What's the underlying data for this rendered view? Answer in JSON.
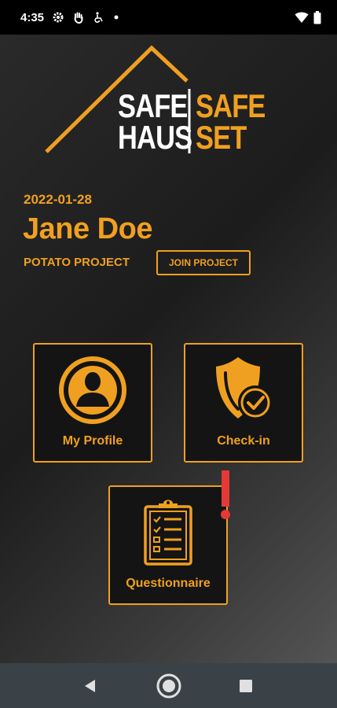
{
  "status_bar": {
    "time": "4:35",
    "icons": [
      "gear-icon",
      "hand-icon",
      "accessibility-icon",
      "dot-icon"
    ],
    "right_icons": [
      "wifi-icon",
      "battery-icon"
    ]
  },
  "logo": {
    "word_left_top": "SAFE",
    "word_left_bottom": "HAUS",
    "word_right_top": "SAFE",
    "word_right_bottom": "SET"
  },
  "profile": {
    "date": "2022-01-28",
    "name": "Jane Doe",
    "project": "POTATO PROJECT",
    "join_label": "JOIN PROJECT"
  },
  "tiles": [
    {
      "label": "My Profile",
      "icon": "person-icon"
    },
    {
      "label": "Check-in",
      "icon": "shield-check-icon"
    },
    {
      "label": "Questionnaire",
      "icon": "clipboard-icon",
      "alert": true
    }
  ],
  "nav": {
    "buttons": [
      "back-icon",
      "home-icon",
      "recents-icon"
    ]
  },
  "colors": {
    "accent": "#f0a020",
    "alert": "#e53935",
    "status_bar": "#000000",
    "nav_bar": "#3a4247"
  }
}
